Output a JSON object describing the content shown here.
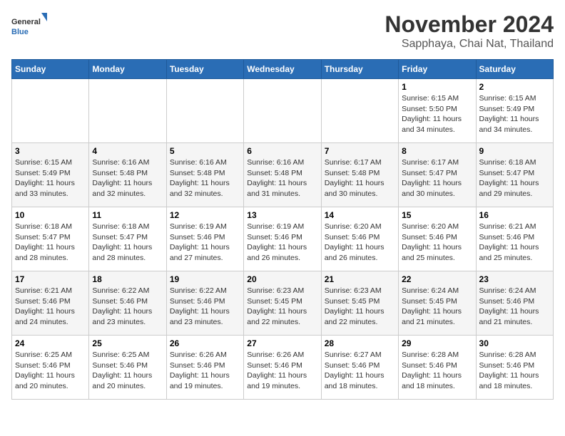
{
  "logo": {
    "text_general": "General",
    "text_blue": "Blue"
  },
  "title": "November 2024",
  "subtitle": "Sapphaya, Chai Nat, Thailand",
  "weekdays": [
    "Sunday",
    "Monday",
    "Tuesday",
    "Wednesday",
    "Thursday",
    "Friday",
    "Saturday"
  ],
  "weeks": [
    [
      {
        "day": "",
        "info": ""
      },
      {
        "day": "",
        "info": ""
      },
      {
        "day": "",
        "info": ""
      },
      {
        "day": "",
        "info": ""
      },
      {
        "day": "",
        "info": ""
      },
      {
        "day": "1",
        "info": "Sunrise: 6:15 AM\nSunset: 5:50 PM\nDaylight: 11 hours and 34 minutes."
      },
      {
        "day": "2",
        "info": "Sunrise: 6:15 AM\nSunset: 5:49 PM\nDaylight: 11 hours and 34 minutes."
      }
    ],
    [
      {
        "day": "3",
        "info": "Sunrise: 6:15 AM\nSunset: 5:49 PM\nDaylight: 11 hours and 33 minutes."
      },
      {
        "day": "4",
        "info": "Sunrise: 6:16 AM\nSunset: 5:48 PM\nDaylight: 11 hours and 32 minutes."
      },
      {
        "day": "5",
        "info": "Sunrise: 6:16 AM\nSunset: 5:48 PM\nDaylight: 11 hours and 32 minutes."
      },
      {
        "day": "6",
        "info": "Sunrise: 6:16 AM\nSunset: 5:48 PM\nDaylight: 11 hours and 31 minutes."
      },
      {
        "day": "7",
        "info": "Sunrise: 6:17 AM\nSunset: 5:48 PM\nDaylight: 11 hours and 30 minutes."
      },
      {
        "day": "8",
        "info": "Sunrise: 6:17 AM\nSunset: 5:47 PM\nDaylight: 11 hours and 30 minutes."
      },
      {
        "day": "9",
        "info": "Sunrise: 6:18 AM\nSunset: 5:47 PM\nDaylight: 11 hours and 29 minutes."
      }
    ],
    [
      {
        "day": "10",
        "info": "Sunrise: 6:18 AM\nSunset: 5:47 PM\nDaylight: 11 hours and 28 minutes."
      },
      {
        "day": "11",
        "info": "Sunrise: 6:18 AM\nSunset: 5:47 PM\nDaylight: 11 hours and 28 minutes."
      },
      {
        "day": "12",
        "info": "Sunrise: 6:19 AM\nSunset: 5:46 PM\nDaylight: 11 hours and 27 minutes."
      },
      {
        "day": "13",
        "info": "Sunrise: 6:19 AM\nSunset: 5:46 PM\nDaylight: 11 hours and 26 minutes."
      },
      {
        "day": "14",
        "info": "Sunrise: 6:20 AM\nSunset: 5:46 PM\nDaylight: 11 hours and 26 minutes."
      },
      {
        "day": "15",
        "info": "Sunrise: 6:20 AM\nSunset: 5:46 PM\nDaylight: 11 hours and 25 minutes."
      },
      {
        "day": "16",
        "info": "Sunrise: 6:21 AM\nSunset: 5:46 PM\nDaylight: 11 hours and 25 minutes."
      }
    ],
    [
      {
        "day": "17",
        "info": "Sunrise: 6:21 AM\nSunset: 5:46 PM\nDaylight: 11 hours and 24 minutes."
      },
      {
        "day": "18",
        "info": "Sunrise: 6:22 AM\nSunset: 5:46 PM\nDaylight: 11 hours and 23 minutes."
      },
      {
        "day": "19",
        "info": "Sunrise: 6:22 AM\nSunset: 5:46 PM\nDaylight: 11 hours and 23 minutes."
      },
      {
        "day": "20",
        "info": "Sunrise: 6:23 AM\nSunset: 5:45 PM\nDaylight: 11 hours and 22 minutes."
      },
      {
        "day": "21",
        "info": "Sunrise: 6:23 AM\nSunset: 5:45 PM\nDaylight: 11 hours and 22 minutes."
      },
      {
        "day": "22",
        "info": "Sunrise: 6:24 AM\nSunset: 5:45 PM\nDaylight: 11 hours and 21 minutes."
      },
      {
        "day": "23",
        "info": "Sunrise: 6:24 AM\nSunset: 5:46 PM\nDaylight: 11 hours and 21 minutes."
      }
    ],
    [
      {
        "day": "24",
        "info": "Sunrise: 6:25 AM\nSunset: 5:46 PM\nDaylight: 11 hours and 20 minutes."
      },
      {
        "day": "25",
        "info": "Sunrise: 6:25 AM\nSunset: 5:46 PM\nDaylight: 11 hours and 20 minutes."
      },
      {
        "day": "26",
        "info": "Sunrise: 6:26 AM\nSunset: 5:46 PM\nDaylight: 11 hours and 19 minutes."
      },
      {
        "day": "27",
        "info": "Sunrise: 6:26 AM\nSunset: 5:46 PM\nDaylight: 11 hours and 19 minutes."
      },
      {
        "day": "28",
        "info": "Sunrise: 6:27 AM\nSunset: 5:46 PM\nDaylight: 11 hours and 18 minutes."
      },
      {
        "day": "29",
        "info": "Sunrise: 6:28 AM\nSunset: 5:46 PM\nDaylight: 11 hours and 18 minutes."
      },
      {
        "day": "30",
        "info": "Sunrise: 6:28 AM\nSunset: 5:46 PM\nDaylight: 11 hours and 18 minutes."
      }
    ]
  ]
}
